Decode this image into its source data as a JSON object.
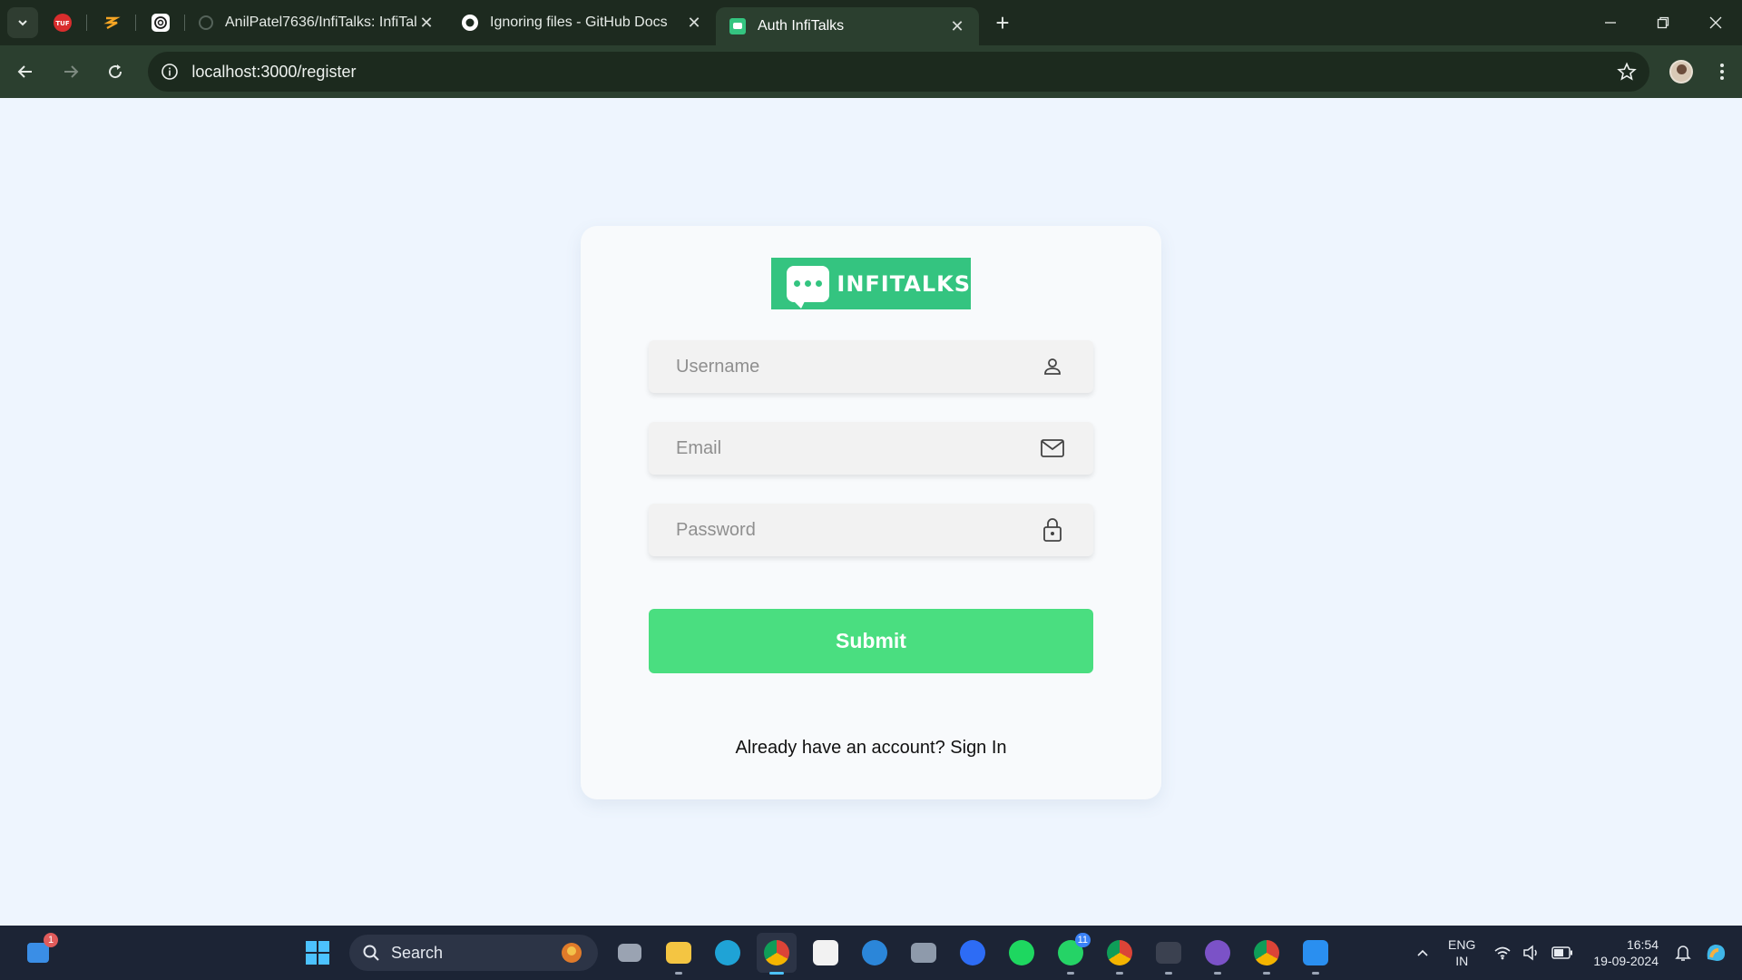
{
  "browser": {
    "tabs": [
      {
        "title": "AnilPatel7636/InfiTalks: InfiTalk",
        "close": "✕"
      },
      {
        "title": "Ignoring files - GitHub Docs",
        "close": "✕"
      },
      {
        "title": "Auth InfiTalks",
        "close": "✕"
      }
    ],
    "pinned_tabs": [
      "TUF",
      "Zuddl",
      "ChatGPT"
    ],
    "address": "localhost:3000/register",
    "new_tab": "+"
  },
  "form": {
    "logo_text": "INFITALKS",
    "username_placeholder": "Username",
    "email_placeholder": "Email",
    "password_placeholder": "Password",
    "submit_label": "Submit",
    "signin_prompt": "Already have an account? Sign In"
  },
  "taskbar": {
    "search_label": "Search",
    "lang_line1": "ENG",
    "lang_line2": "IN",
    "time": "16:54",
    "date": "19-09-2024",
    "whatsapp_badge": "11",
    "widgets_badge": "1",
    "apps": [
      "file-explorer",
      "edge",
      "chrome",
      "store",
      "help",
      "camera",
      "zoom",
      "spotify",
      "whatsapp",
      "chrome-profile-a",
      "terminal",
      "github",
      "chrome-profile-r",
      "vscode"
    ]
  },
  "colors": {
    "accent_green": "#4ade80",
    "logo_green": "#34c480",
    "page_bg": "#eef5fe",
    "browser_dark": "#1d2a1f"
  }
}
